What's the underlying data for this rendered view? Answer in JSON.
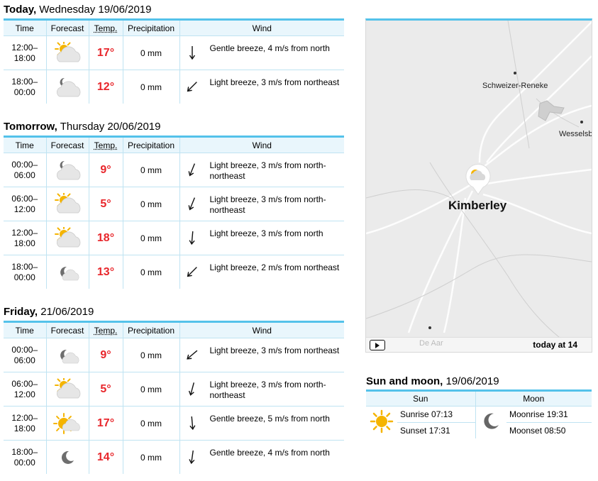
{
  "headers": {
    "time": "Time",
    "forecast": "Forecast",
    "temp": "Temp.",
    "precip": "Precipitation",
    "wind": "Wind"
  },
  "days": [
    {
      "title_bold": "Today,",
      "title_rest": " Wednesday 19/06/2019",
      "rows": [
        {
          "t1": "12:00–",
          "t2": "18:00",
          "icon": "partly-cloudy-day",
          "temp": "17°",
          "precip": "0 mm",
          "wind": "Gentle breeze, 4 m/s from north",
          "dir": 0
        },
        {
          "t1": "18:00–",
          "t2": "00:00",
          "icon": "partly-cloudy-night",
          "temp": "12°",
          "precip": "0 mm",
          "wind": "Light breeze, 3 m/s from northeast",
          "dir": 45
        }
      ]
    },
    {
      "title_bold": "Tomorrow,",
      "title_rest": " Thursday 20/06/2019",
      "rows": [
        {
          "t1": "00:00–",
          "t2": "06:00",
          "icon": "partly-cloudy-night",
          "temp": "9°",
          "precip": "0 mm",
          "wind": "Light breeze, 3 m/s from north-northeast",
          "dir": 22
        },
        {
          "t1": "06:00–",
          "t2": "12:00",
          "icon": "partly-cloudy-day",
          "temp": "5°",
          "precip": "0 mm",
          "wind": "Light breeze, 3 m/s from north-northeast",
          "dir": 22
        },
        {
          "t1": "12:00–",
          "t2": "18:00",
          "icon": "partly-cloudy-day",
          "temp": "18°",
          "precip": "0 mm",
          "wind": "Light breeze, 3 m/s from north",
          "dir": 5
        },
        {
          "t1": "18:00–",
          "t2": "00:00",
          "icon": "fair-night",
          "temp": "13°",
          "precip": "0 mm",
          "wind": "Light breeze, 2 m/s from northeast",
          "dir": 45
        }
      ]
    },
    {
      "title_bold": "Friday,",
      "title_rest": " 21/06/2019",
      "rows": [
        {
          "t1": "00:00–",
          "t2": "06:00",
          "icon": "fair-night",
          "temp": "9°",
          "precip": "0 mm",
          "wind": "Light breeze, 3 m/s from northeast",
          "dir": 50
        },
        {
          "t1": "06:00–",
          "t2": "12:00",
          "icon": "partly-cloudy-day",
          "temp": "5°",
          "precip": "0 mm",
          "wind": "Light breeze, 3 m/s from north-northeast",
          "dir": 15
        },
        {
          "t1": "12:00–",
          "t2": "18:00",
          "icon": "sun-cloud",
          "temp": "17°",
          "precip": "0 mm",
          "wind": "Gentle breeze, 5 m/s from north",
          "dir": -5
        },
        {
          "t1": "18:00–",
          "t2": "00:00",
          "icon": "moon",
          "temp": "14°",
          "precip": "0 mm",
          "wind": "Gentle breeze, 4 m/s from north",
          "dir": 8
        }
      ]
    }
  ],
  "map": {
    "city": "Kimberley",
    "places": [
      "Schweizer-Reneke",
      "Wesselsb",
      "De Aar"
    ],
    "timestamp": "today at 14"
  },
  "sunmoon": {
    "title_bold": "Sun and moon,",
    "title_rest": " 19/06/2019",
    "sun_header": "Sun",
    "moon_header": "Moon",
    "sunrise": "Sunrise 07:13",
    "sunset": "Sunset 17:31",
    "moonrise": "Moonrise 19:31",
    "moonset": "Moonset 08:50"
  },
  "colors": {
    "accent": "#54c2ea",
    "temp": "#e8262b",
    "header_bg": "#e9f6fc"
  }
}
